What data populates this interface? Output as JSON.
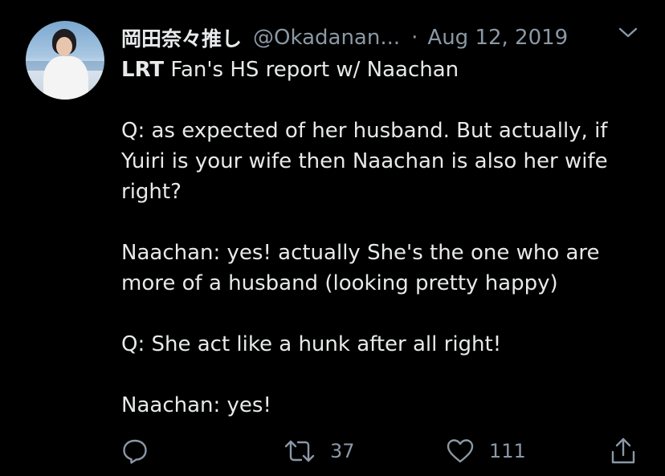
{
  "tweet": {
    "display_name": "岡田奈々推し",
    "handle": "@Okadanan...",
    "separator": "·",
    "date": "Aug 12, 2019",
    "body": {
      "lead_bold": "LRT",
      "lead_rest": " Fan's HS report w/ Naachan",
      "q1_line1": "Q: as expected of her husband. But actually, if",
      "q1_line2": "Yuiri is your wife then Naachan is also her wife",
      "q1_line3": "right?",
      "a1_line1": "Naachan: yes! actually She's the one who are",
      "a1_line2": "more of a husband (looking pretty happy)",
      "q2_line1": "Q: She act like a hunk after all right!",
      "a2_line1": "Naachan: yes!"
    },
    "actions": {
      "reply_icon": "reply-icon",
      "retweet_icon": "retweet-icon",
      "retweet_count": "37",
      "like_icon": "heart-icon",
      "like_count": "111",
      "share_icon": "share-icon"
    },
    "colors": {
      "background": "#000000",
      "text": "#e7e9ea",
      "muted": "#8b98a5"
    }
  }
}
